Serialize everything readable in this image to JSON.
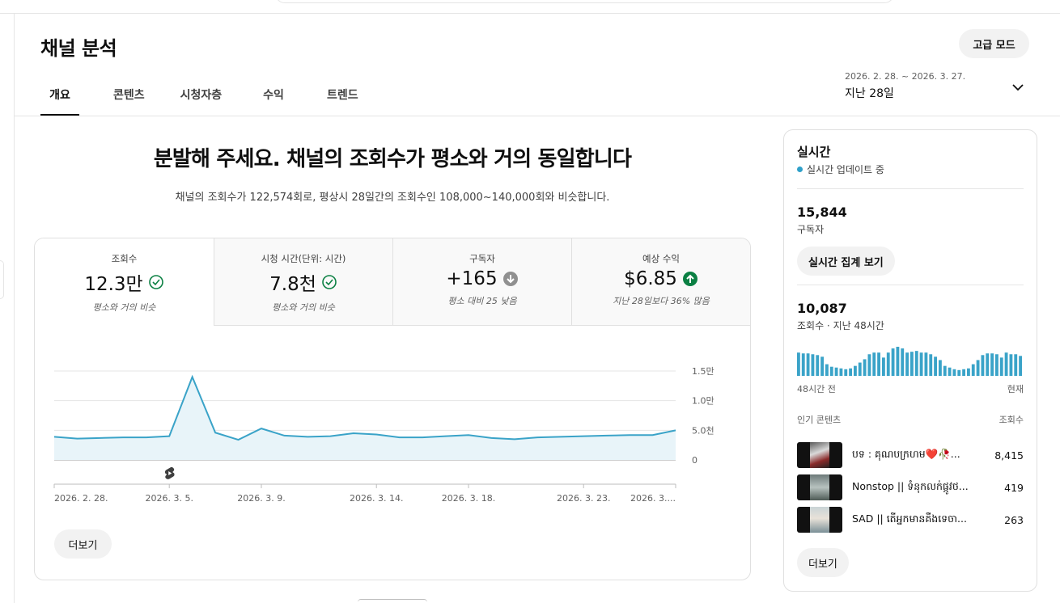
{
  "page": {
    "title": "채널 분석",
    "advanced_mode": "고급 모드"
  },
  "tabs": [
    "개요",
    "콘텐츠",
    "시청자층",
    "수익",
    "트렌드"
  ],
  "date_range": {
    "range": "2026. 2. 28. ~ 2026. 3. 27.",
    "label": "지난 28일"
  },
  "summary": {
    "headline": "분발해 주세요. 채널의 조회수가 평소와 거의 동일합니다",
    "subline": "채널의 조회수가 122,574회로, 평상시 28일간의 조회수인 108,000~140,000회와 비슷합니다."
  },
  "metrics": [
    {
      "label": "조회수",
      "value": "12.3만",
      "note": "평소와 거의 비슷",
      "status": "check"
    },
    {
      "label": "시청 시간(단위: 시간)",
      "value": "7.8천",
      "note": "평소와 거의 비슷",
      "status": "check"
    },
    {
      "label": "구독자",
      "value": "+165",
      "note": "평소 대비 25 낮음",
      "status": "down"
    },
    {
      "label": "예상 수익",
      "value": "$6.85",
      "note": "지난 28일보다 36% 많음",
      "status": "up"
    }
  ],
  "status_colors": {
    "check": "#0b8043",
    "down": "#909090",
    "up": "#0b8043",
    "line": "#3aa3c8"
  },
  "more_label": "더보기",
  "chart_data": {
    "type": "area",
    "x": [
      "2026-02-28",
      "2026-03-01",
      "2026-03-02",
      "2026-03-03",
      "2026-03-04",
      "2026-03-05",
      "2026-03-06",
      "2026-03-07",
      "2026-03-08",
      "2026-03-09",
      "2026-03-10",
      "2026-03-11",
      "2026-03-12",
      "2026-03-13",
      "2026-03-14",
      "2026-03-15",
      "2026-03-16",
      "2026-03-17",
      "2026-03-18",
      "2026-03-19",
      "2026-03-20",
      "2026-03-21",
      "2026-03-22",
      "2026-03-23",
      "2026-03-24",
      "2026-03-25",
      "2026-03-26",
      "2026-03-27"
    ],
    "values": [
      3900,
      3600,
      3700,
      3800,
      3800,
      4000,
      14000,
      4600,
      3400,
      5300,
      4100,
      3900,
      4000,
      4500,
      4300,
      3800,
      3800,
      4000,
      4200,
      3700,
      3500,
      3800,
      3900,
      4000,
      4100,
      4200,
      4200,
      5000
    ],
    "x_ticks": [
      "2026. 2. 28.",
      "2026. 3. 5.",
      "2026. 3. 9.",
      "2026. 3. 14.",
      "2026. 3. 18.",
      "2026. 3. 23.",
      "2026. 3...."
    ],
    "x_tick_dates": [
      "2026-02-28",
      "2026-03-05",
      "2026-03-09",
      "2026-03-14",
      "2026-03-18",
      "2026-03-23",
      "2026-03-27"
    ],
    "y_ticks": [
      {
        "value": 15000,
        "label": "1.5만"
      },
      {
        "value": 10000,
        "label": "1.0만"
      },
      {
        "value": 5000,
        "label": "5.0천"
      },
      {
        "value": 0,
        "label": "0"
      }
    ],
    "ylim": [
      0,
      15000
    ],
    "grid": true,
    "marker_date": "2026-03-05"
  },
  "realtime": {
    "title": "실시간",
    "live_label": "실시간 업데이트 중",
    "subscribers": "15,844",
    "subscribers_label": "구독자",
    "report_button": "실시간 집계 보기",
    "views": "10,087",
    "views_label": "조회수 · 지난 48시간",
    "hourly_views": [
      28,
      27,
      27,
      26,
      25,
      23,
      14,
      11,
      10,
      9,
      8,
      9,
      12,
      16,
      20,
      26,
      28,
      28,
      22,
      28,
      33,
      35,
      33,
      28,
      29,
      30,
      28,
      28,
      26,
      23,
      19,
      12,
      10,
      8,
      7,
      8,
      9,
      14,
      19,
      25,
      27,
      27,
      26,
      22,
      28,
      26,
      26,
      24
    ],
    "axis_start": "48시간 전",
    "axis_end": "현재",
    "popular_header": "인기 콘텐츠",
    "popular_views_header": "조회수",
    "popular": [
      {
        "title": "បទ : គុណបក្រហម❤️🥀...",
        "views": "8,415"
      },
      {
        "title": "Nonstop || ទំនុកលក់ផ្កូវថ...",
        "views": "419"
      },
      {
        "title": "SAD || តើអ្នកមានគឺងទេចា...",
        "views": "263"
      }
    ],
    "more_label": "더보기"
  }
}
